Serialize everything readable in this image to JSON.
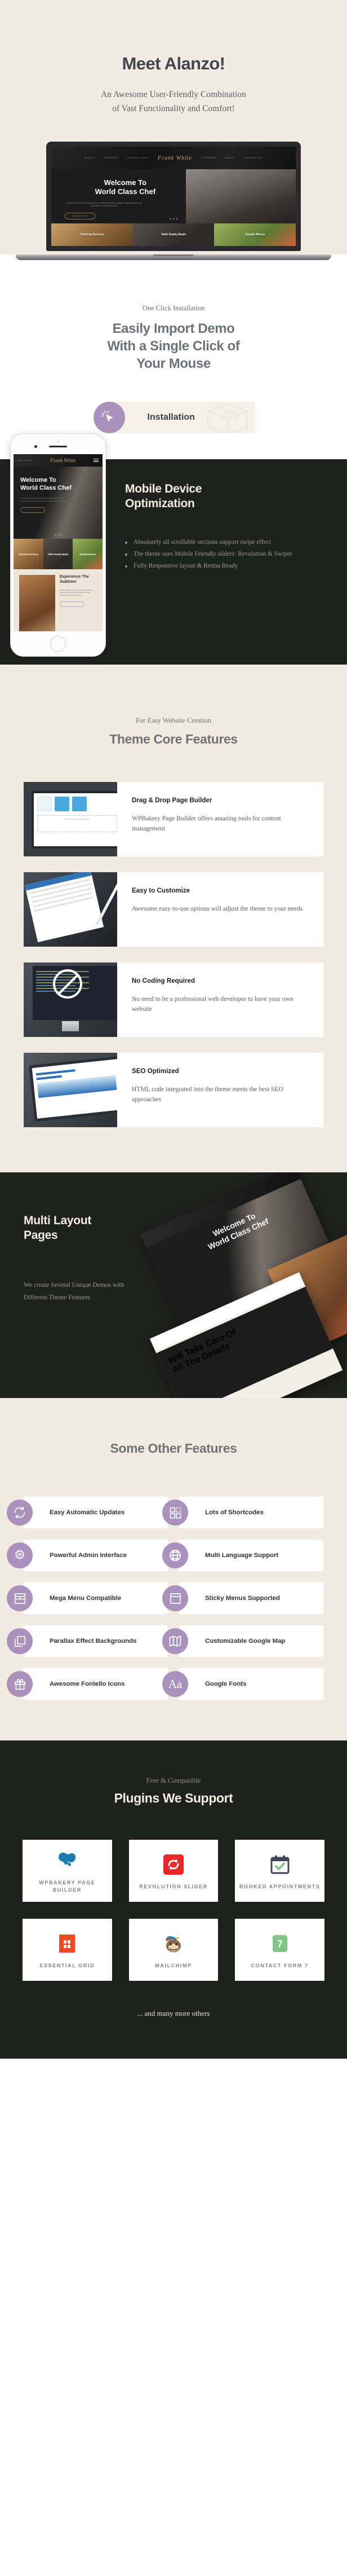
{
  "hero": {
    "title": "Meet Alanzo!",
    "subtitle_line1": "An Awesome User-Friendly Combination",
    "subtitle_line2": "of Vast Functionality  and Comfort!",
    "laptop_nav": [
      "MENUS",
      "SERVICES",
      "PRIVATE CHEF",
      "CATERING",
      "ABOUT",
      "CONTACT US"
    ],
    "laptop_logo": "Frank White",
    "laptop_heading_line1": "Welcome To",
    "laptop_heading_line2": "World Class Chef",
    "laptop_paragraph": "Hiring A Personal Chef, Family dinners, date night, brunch, parties and get-togethers, and even dinner for the entire week.",
    "laptop_button": "CONTACT US",
    "laptop_tiles": [
      "Catering Services",
      "Table Ready Meals",
      "Sample Menus"
    ]
  },
  "oneclick": {
    "eyebrow": "One Click Installation",
    "heading_line1": "Easily Import Demo",
    "heading_line2": "With a Single Click of",
    "heading_line3": "Your Mouse",
    "button_label": "Installation"
  },
  "mobile": {
    "heading_line1": "Mobile Device",
    "heading_line2": "Optimization",
    "bullets": [
      "Absolutely all scrollable sections support swipe effect",
      "The theme uses Mobile Friendly sliders: Revolution & Swiper",
      "Fully Responsive layout & Retina Ready"
    ],
    "phone_logo": "Frank White",
    "phone_heading_line1": "Welcome To",
    "phone_heading_line2": "World Class Chef",
    "phone_phone": "1 800 123 4567",
    "phone_tiles": [
      "Catering Services",
      "Table Ready Meals",
      "Sample Menus"
    ],
    "phone_exp_line1": "Experience The",
    "phone_exp_line2": "Sublime!"
  },
  "core": {
    "eyebrow": "For Easy Website Creation",
    "heading": "Theme Core Features",
    "features": [
      {
        "title": "Drag & Drop Page  Builder",
        "desc": "WPBakery Page Builder offers amazing tools for content management",
        "art_caption": "Drag here to add widgets"
      },
      {
        "title": "Easy to Customize",
        "desc": "Awesome easy-to-use options will adjust the theme to your needs",
        "art_caption": ""
      },
      {
        "title": "No Coding Required",
        "desc": "No need to be a professional web developer to have your own website",
        "art_caption": ""
      },
      {
        "title": "SEO Optimized",
        "desc": "HTML code integrated into the theme meets the best SEO approaches",
        "art_caption": ""
      }
    ]
  },
  "multi": {
    "heading_line1": "Multi Layout",
    "heading_line2": "Pages",
    "paragraph": "We create Several Unique Demos with Different Theme Features"
  },
  "other": {
    "heading": "Some Other Features",
    "items": [
      {
        "label": "Easy Automatic Updates",
        "icon": "refresh-icon"
      },
      {
        "label": "Lots of Shortcodes",
        "icon": "grid-blocks-icon"
      },
      {
        "label": "Powerful Admin Interface",
        "icon": "gear-icon"
      },
      {
        "label": "Multi Language Support",
        "icon": "globe-icon"
      },
      {
        "label": "Mega Menu Compatible",
        "icon": "mega-menu-icon"
      },
      {
        "label": "Sticky Menus Supported",
        "icon": "sticky-window-icon"
      },
      {
        "label": "Parallax Effect Backgrounds",
        "icon": "layers-icon"
      },
      {
        "label": "Customizable Google Map",
        "icon": "map-icon"
      },
      {
        "label": "Awesome Fontello Icons",
        "icon": "gift-icon"
      },
      {
        "label": "Google Fonts",
        "icon": "typography-icon"
      }
    ]
  },
  "plugins": {
    "eyebrow": "Free & Compatible",
    "heading": "Plugins We Support",
    "items": [
      {
        "name": "WPBAKERY PAGE BUILDER",
        "icon": "wpbakery-logo",
        "color": "#1c7bb0"
      },
      {
        "name": "REVOLUTION SLIDER",
        "icon": "revolution-slider-logo",
        "color": "#e8282b"
      },
      {
        "name": "BOOKED APPOINTMENTS",
        "icon": "booked-calendar-logo",
        "color": "#3f4458"
      },
      {
        "name": "ESSENTIAL GRID",
        "icon": "essential-grid-logo",
        "color": "#f04a22"
      },
      {
        "name": "MAILCHIMP",
        "icon": "mailchimp-logo",
        "color": "#7a5c42"
      },
      {
        "name": "CONTACT FORM 7",
        "icon": "contact-form-7-logo",
        "color": "#81c784"
      }
    ],
    "footer_note": "... and many more others"
  },
  "colors": {
    "beige": "#f2ebe1",
    "dark": "#1f211e",
    "purple": "#ab92bd",
    "heading_gray": "#6f7277",
    "cream_text": "#f3ece1"
  }
}
